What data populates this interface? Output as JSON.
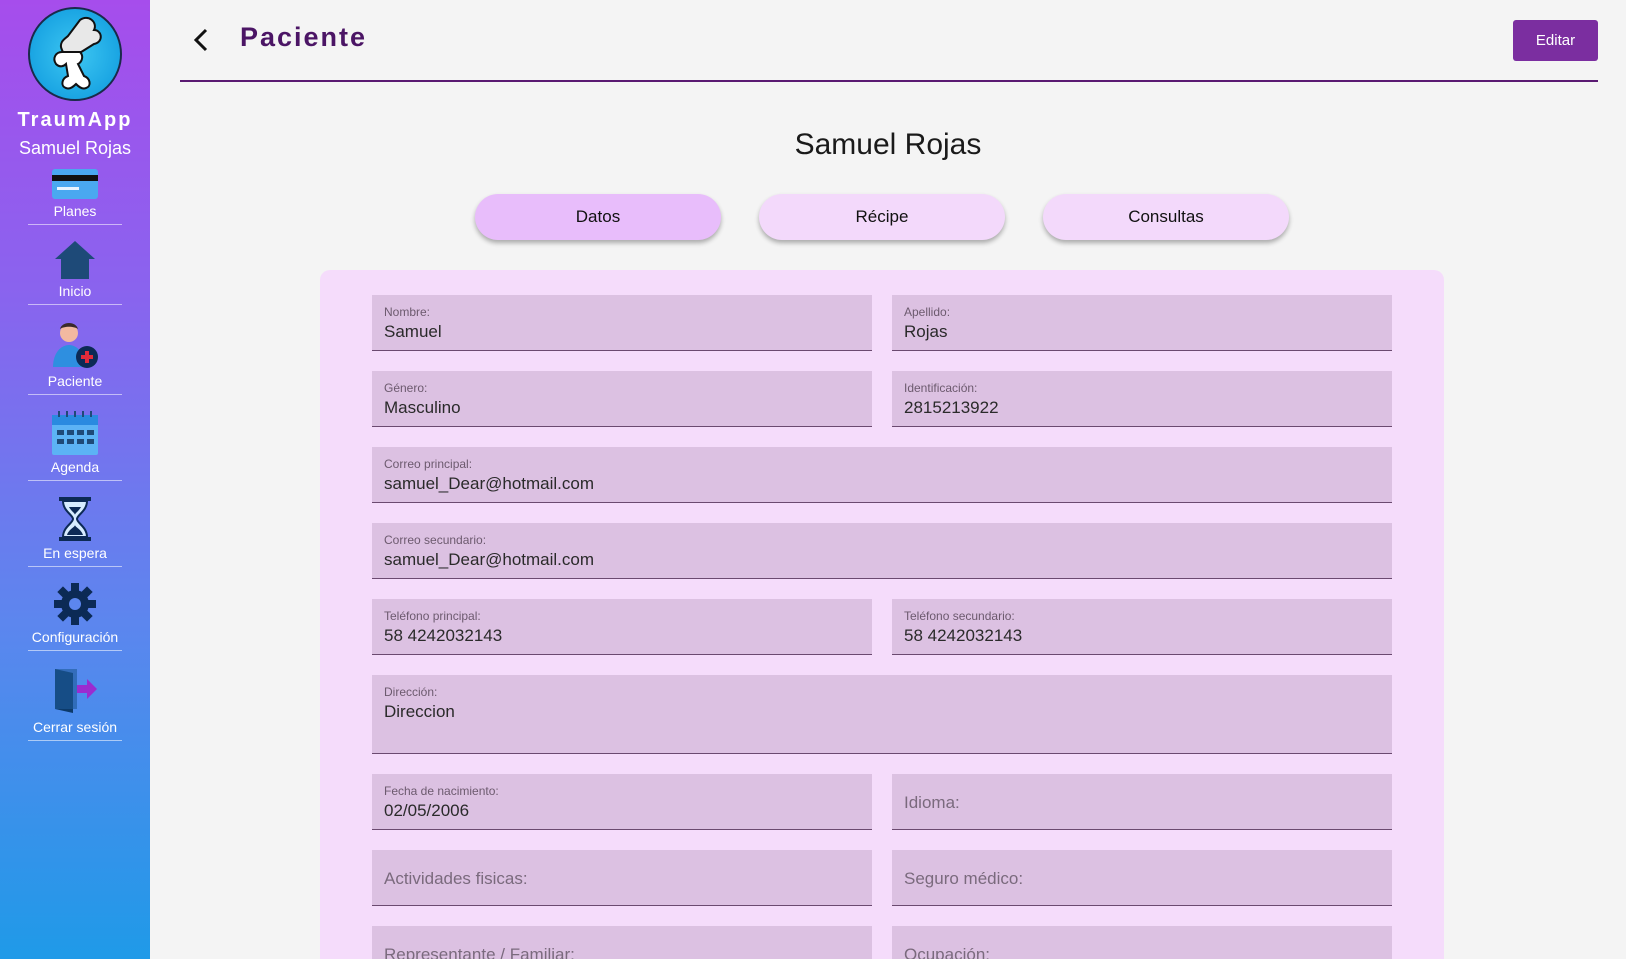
{
  "sidebar": {
    "app_name": "TraumApp",
    "user_name": "Samuel Rojas",
    "items": [
      {
        "label": "Planes",
        "icon": "card-icon"
      },
      {
        "label": "Inicio",
        "icon": "home-icon"
      },
      {
        "label": "Paciente",
        "icon": "add-patient-icon"
      },
      {
        "label": "Agenda",
        "icon": "calendar-icon"
      },
      {
        "label": "En espera",
        "icon": "hourglass-icon"
      },
      {
        "label": "Configuración",
        "icon": "gear-icon"
      },
      {
        "label": "Cerrar sesión",
        "icon": "logout-icon"
      }
    ]
  },
  "header": {
    "title": "Paciente",
    "edit_label": "Editar"
  },
  "patient": {
    "full_name": "Samuel Rojas"
  },
  "tabs": [
    {
      "label": "Datos",
      "active": true
    },
    {
      "label": "Récipe",
      "active": false
    },
    {
      "label": "Consultas",
      "active": false
    }
  ],
  "form": {
    "nombre": {
      "label": "Nombre:",
      "value": "Samuel"
    },
    "apellido": {
      "label": "Apellido:",
      "value": "Rojas"
    },
    "genero": {
      "label": "Género:",
      "value": "Masculino"
    },
    "identificacion": {
      "label": "Identificación:",
      "value": "2815213922"
    },
    "correo_principal": {
      "label": "Correo principal:",
      "value": "samuel_Dear@hotmail.com"
    },
    "correo_secundario": {
      "label": "Correo secundario:",
      "value": "samuel_Dear@hotmail.com"
    },
    "telefono_principal": {
      "label": "Teléfono principal:",
      "value": "58 4242032143"
    },
    "telefono_secundario": {
      "label": "Teléfono secundario:",
      "value": "58 4242032143"
    },
    "direccion": {
      "label": "Dirección:",
      "value": "Direccion"
    },
    "fecha_nacimiento": {
      "label": "Fecha de nacimiento:",
      "value": "02/05/2006"
    },
    "idioma": {
      "placeholder": "Idioma:"
    },
    "actividades": {
      "placeholder": "Actividades fisicas:"
    },
    "seguro": {
      "placeholder": "Seguro médico:"
    },
    "representante": {
      "placeholder": "Representante / Familiar:"
    },
    "ocupacion": {
      "placeholder": "Ocupación:"
    }
  },
  "colors": {
    "accent": "#7b2ea0",
    "title": "#4b1565",
    "tab_active": "#e8bdfb",
    "tab": "#f3d9fb",
    "card": "#f5dcfb",
    "field": "#dcc1e2"
  }
}
